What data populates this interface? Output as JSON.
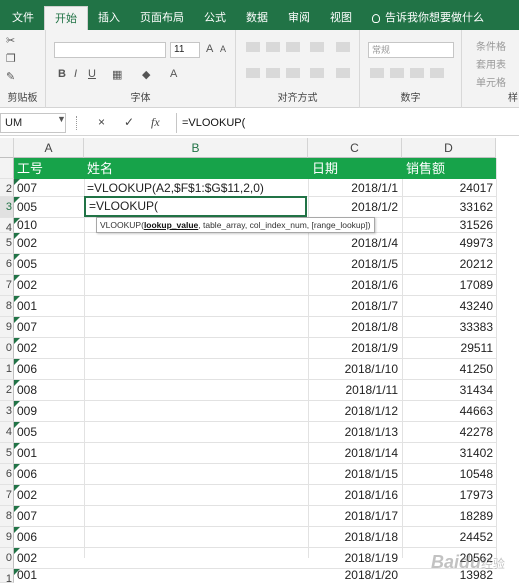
{
  "tabs": [
    "文件",
    "开始",
    "插入",
    "页面布局",
    "公式",
    "数据",
    "审阅",
    "视图"
  ],
  "tell_me": "告诉我你想要做什么",
  "ribbon": {
    "clipboard_label": "剪贴板",
    "font_label": "字体",
    "align_label": "对齐方式",
    "number_label": "数字",
    "styles_label": "样",
    "font_size": "11",
    "number_format": "常规",
    "cond_format": "条件格",
    "table_format": "套用表",
    "cell_styles": "单元格"
  },
  "formula_bar": {
    "name_box": "UM",
    "cancel": "×",
    "enter": "✓",
    "fx": "fx",
    "content": "=VLOOKUP("
  },
  "columns": [
    "A",
    "B",
    "C",
    "D"
  ],
  "header_row": {
    "rownum": "",
    "a": "工号",
    "b": "姓名",
    "c": "日期",
    "d": "销售额"
  },
  "rows": [
    {
      "rownum": "2",
      "a": "007",
      "b": "=VLOOKUP(A2,$F$1:$G$11,2,0)",
      "c": "2018/1/1",
      "d": "24017"
    },
    {
      "rownum": "3",
      "a": "005",
      "b": "",
      "c": "2018/1/2",
      "d": "33162"
    },
    {
      "rownum": "4",
      "a": "010",
      "b": "",
      "c": "",
      "d": "31526"
    },
    {
      "rownum": "5",
      "a": "002",
      "b": "",
      "c": "2018/1/4",
      "d": "49973"
    },
    {
      "rownum": "6",
      "a": "005",
      "b": "",
      "c": "2018/1/5",
      "d": "20212"
    },
    {
      "rownum": "7",
      "a": "002",
      "b": "",
      "c": "2018/1/6",
      "d": "17089"
    },
    {
      "rownum": "8",
      "a": "001",
      "b": "",
      "c": "2018/1/7",
      "d": "43240"
    },
    {
      "rownum": "9",
      "a": "007",
      "b": "",
      "c": "2018/1/8",
      "d": "33383"
    },
    {
      "rownum": "0",
      "a": "002",
      "b": "",
      "c": "2018/1/9",
      "d": "29511"
    },
    {
      "rownum": "1",
      "a": "006",
      "b": "",
      "c": "2018/1/10",
      "d": "41250"
    },
    {
      "rownum": "2",
      "a": "008",
      "b": "",
      "c": "2018/1/11",
      "d": "31434"
    },
    {
      "rownum": "3",
      "a": "009",
      "b": "",
      "c": "2018/1/12",
      "d": "44663"
    },
    {
      "rownum": "4",
      "a": "005",
      "b": "",
      "c": "2018/1/13",
      "d": "42278"
    },
    {
      "rownum": "5",
      "a": "001",
      "b": "",
      "c": "2018/1/14",
      "d": "31402"
    },
    {
      "rownum": "6",
      "a": "006",
      "b": "",
      "c": "2018/1/15",
      "d": "10548"
    },
    {
      "rownum": "7",
      "a": "002",
      "b": "",
      "c": "2018/1/16",
      "d": "17973"
    },
    {
      "rownum": "8",
      "a": "007",
      "b": "",
      "c": "2018/1/17",
      "d": "18289"
    },
    {
      "rownum": "9",
      "a": "006",
      "b": "",
      "c": "2018/1/18",
      "d": "24452"
    },
    {
      "rownum": "0",
      "a": "002",
      "b": "",
      "c": "2018/1/19",
      "d": "20562"
    },
    {
      "rownum": "1",
      "a": "001",
      "b": "",
      "c": "2018/1/20",
      "d": "13982"
    }
  ],
  "active_cell_text": "=VLOOKUP(",
  "tooltip": {
    "fn": "VLOOKUP(",
    "arg1": "lookup_value",
    "rest": ", table_array, col_index_num, [range_lookup])"
  },
  "watermark": "Baidu",
  "watermark_sub": "经验",
  "colors": {
    "accent": "#217346",
    "header_fill": "#17a34a"
  }
}
